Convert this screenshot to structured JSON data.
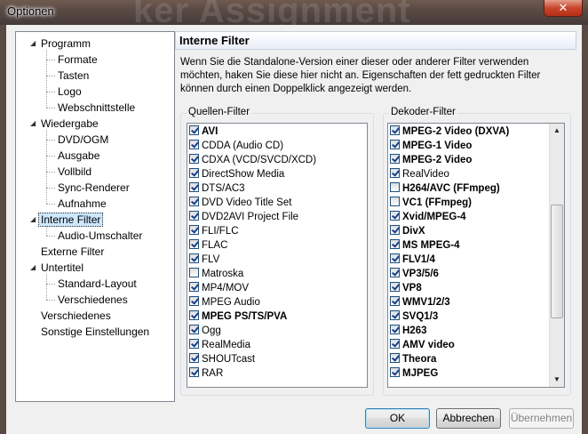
{
  "window": {
    "title": "Optionen",
    "background_text": "ker Assignment",
    "close_glyph": "✕"
  },
  "tree": {
    "items": [
      {
        "label": "Programm",
        "level": 0,
        "expanded": true
      },
      {
        "label": "Formate",
        "level": 1
      },
      {
        "label": "Tasten",
        "level": 1
      },
      {
        "label": "Logo",
        "level": 1
      },
      {
        "label": "Webschnittstelle",
        "level": 1
      },
      {
        "label": "Wiedergabe",
        "level": 0,
        "expanded": true
      },
      {
        "label": "DVD/OGM",
        "level": 1
      },
      {
        "label": "Ausgabe",
        "level": 1
      },
      {
        "label": "Vollbild",
        "level": 1
      },
      {
        "label": "Sync-Renderer",
        "level": 1
      },
      {
        "label": "Aufnahme",
        "level": 1
      },
      {
        "label": "Interne Filter",
        "level": 0,
        "expanded": true,
        "selected": true
      },
      {
        "label": "Audio-Umschalter",
        "level": 1
      },
      {
        "label": "Externe Filter",
        "level": 0
      },
      {
        "label": "Untertitel",
        "level": 0,
        "expanded": true
      },
      {
        "label": "Standard-Layout",
        "level": 1
      },
      {
        "label": "Verschiedenes",
        "level": 1
      },
      {
        "label": "Verschiedenes",
        "level": 0
      },
      {
        "label": "Sonstige Einstellungen",
        "level": 0
      }
    ]
  },
  "panel": {
    "title": "Interne Filter",
    "description": "Wenn Sie die Standalone-Version einer dieser oder anderer Filter verwenden möchten, haken Sie diese hier nicht an. Eigenschaften der fett gedruckten Filter können durch einen Doppelklick angezeigt werden."
  },
  "source_filters": {
    "label": "Quellen-Filter",
    "items": [
      {
        "label": "AVI",
        "checked": true,
        "bold": true
      },
      {
        "label": "CDDA (Audio CD)",
        "checked": true,
        "bold": false
      },
      {
        "label": "CDXA (VCD/SVCD/XCD)",
        "checked": true,
        "bold": false
      },
      {
        "label": "DirectShow Media",
        "checked": true,
        "bold": false
      },
      {
        "label": "DTS/AC3",
        "checked": true,
        "bold": false
      },
      {
        "label": "DVD Video Title Set",
        "checked": true,
        "bold": false
      },
      {
        "label": "DVD2AVI Project File",
        "checked": true,
        "bold": false
      },
      {
        "label": "FLI/FLC",
        "checked": true,
        "bold": false
      },
      {
        "label": "FLAC",
        "checked": true,
        "bold": false
      },
      {
        "label": "FLV",
        "checked": true,
        "bold": false
      },
      {
        "label": "Matroska",
        "checked": false,
        "bold": false
      },
      {
        "label": "MP4/MOV",
        "checked": true,
        "bold": false
      },
      {
        "label": "MPEG Audio",
        "checked": true,
        "bold": false
      },
      {
        "label": "MPEG PS/TS/PVA",
        "checked": true,
        "bold": true
      },
      {
        "label": "Ogg",
        "checked": true,
        "bold": false
      },
      {
        "label": "RealMedia",
        "checked": true,
        "bold": false
      },
      {
        "label": "SHOUTcast",
        "checked": true,
        "bold": false
      },
      {
        "label": "RAR",
        "checked": true,
        "bold": false
      }
    ]
  },
  "decoder_filters": {
    "label": "Dekoder-Filter",
    "items": [
      {
        "label": "MPEG-2 Video (DXVA)",
        "checked": true,
        "bold": true
      },
      {
        "label": "MPEG-1 Video",
        "checked": true,
        "bold": true
      },
      {
        "label": "MPEG-2 Video",
        "checked": true,
        "bold": true
      },
      {
        "label": "RealVideo",
        "checked": true,
        "bold": false
      },
      {
        "label": "H264/AVC (FFmpeg)",
        "checked": false,
        "bold": true
      },
      {
        "label": "VC1 (FFmpeg)",
        "checked": false,
        "bold": true
      },
      {
        "label": "Xvid/MPEG-4",
        "checked": true,
        "bold": true
      },
      {
        "label": "DivX",
        "checked": true,
        "bold": true
      },
      {
        "label": "MS MPEG-4",
        "checked": true,
        "bold": true
      },
      {
        "label": "FLV1/4",
        "checked": true,
        "bold": true
      },
      {
        "label": "VP3/5/6",
        "checked": true,
        "bold": true
      },
      {
        "label": "VP8",
        "checked": true,
        "bold": true
      },
      {
        "label": "WMV1/2/3",
        "checked": true,
        "bold": true
      },
      {
        "label": "SVQ1/3",
        "checked": true,
        "bold": true
      },
      {
        "label": "H263",
        "checked": true,
        "bold": true
      },
      {
        "label": "AMV video",
        "checked": true,
        "bold": true
      },
      {
        "label": "Theora",
        "checked": true,
        "bold": true
      },
      {
        "label": "MJPEG",
        "checked": true,
        "bold": true
      }
    ],
    "scroll_position": 0.55
  },
  "buttons": {
    "ok": "OK",
    "cancel": "Abbrechen",
    "apply": "Übernehmen"
  }
}
